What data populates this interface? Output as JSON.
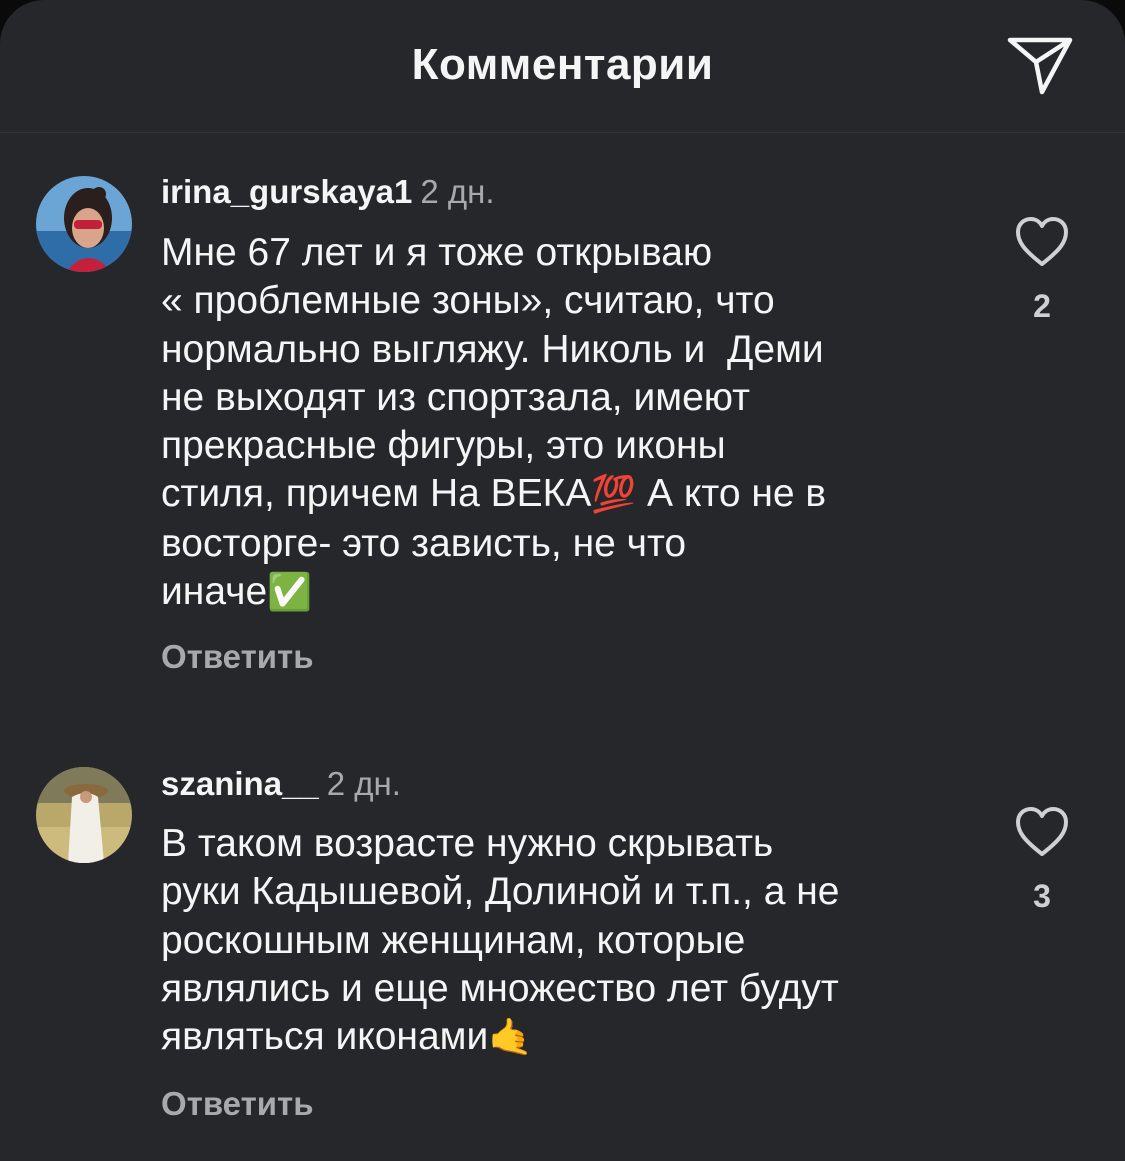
{
  "header": {
    "title": "Комментарии",
    "share_icon": "paper-plane-icon"
  },
  "comments": [
    {
      "username": "irina_gurskaya1",
      "time": "2 дн.",
      "text": "Мне 67 лет и я тоже открываю\n« проблемные зоны», считаю, что\nнормально выгляжу. Николь и  Деми\nне выходят из спортзала, имеют\nпрекрасные фигуры, это иконы\nстиля, причем На ВЕКА",
      "emoji_1": "💯",
      "text_2": " А кто не в\nвосторге- это зависть, не что\nиначе",
      "emoji_2": "✅",
      "reply": "Ответить",
      "likes": "2"
    },
    {
      "username": "szanina__",
      "time": "2 дн.",
      "text": "В таком возрасте нужно скрывать\nруки Кадышевой, Долиной и т.п., а не\nроскошным женщинам, которые\nявлялись и еще множество лет будут\nявляться иконами",
      "emoji_1": "🤙",
      "reply": "Ответить",
      "likes": "3"
    }
  ],
  "colors": {
    "background": "#26272b",
    "text": "#f5f5f5",
    "secondary": "#a8a8ad"
  }
}
